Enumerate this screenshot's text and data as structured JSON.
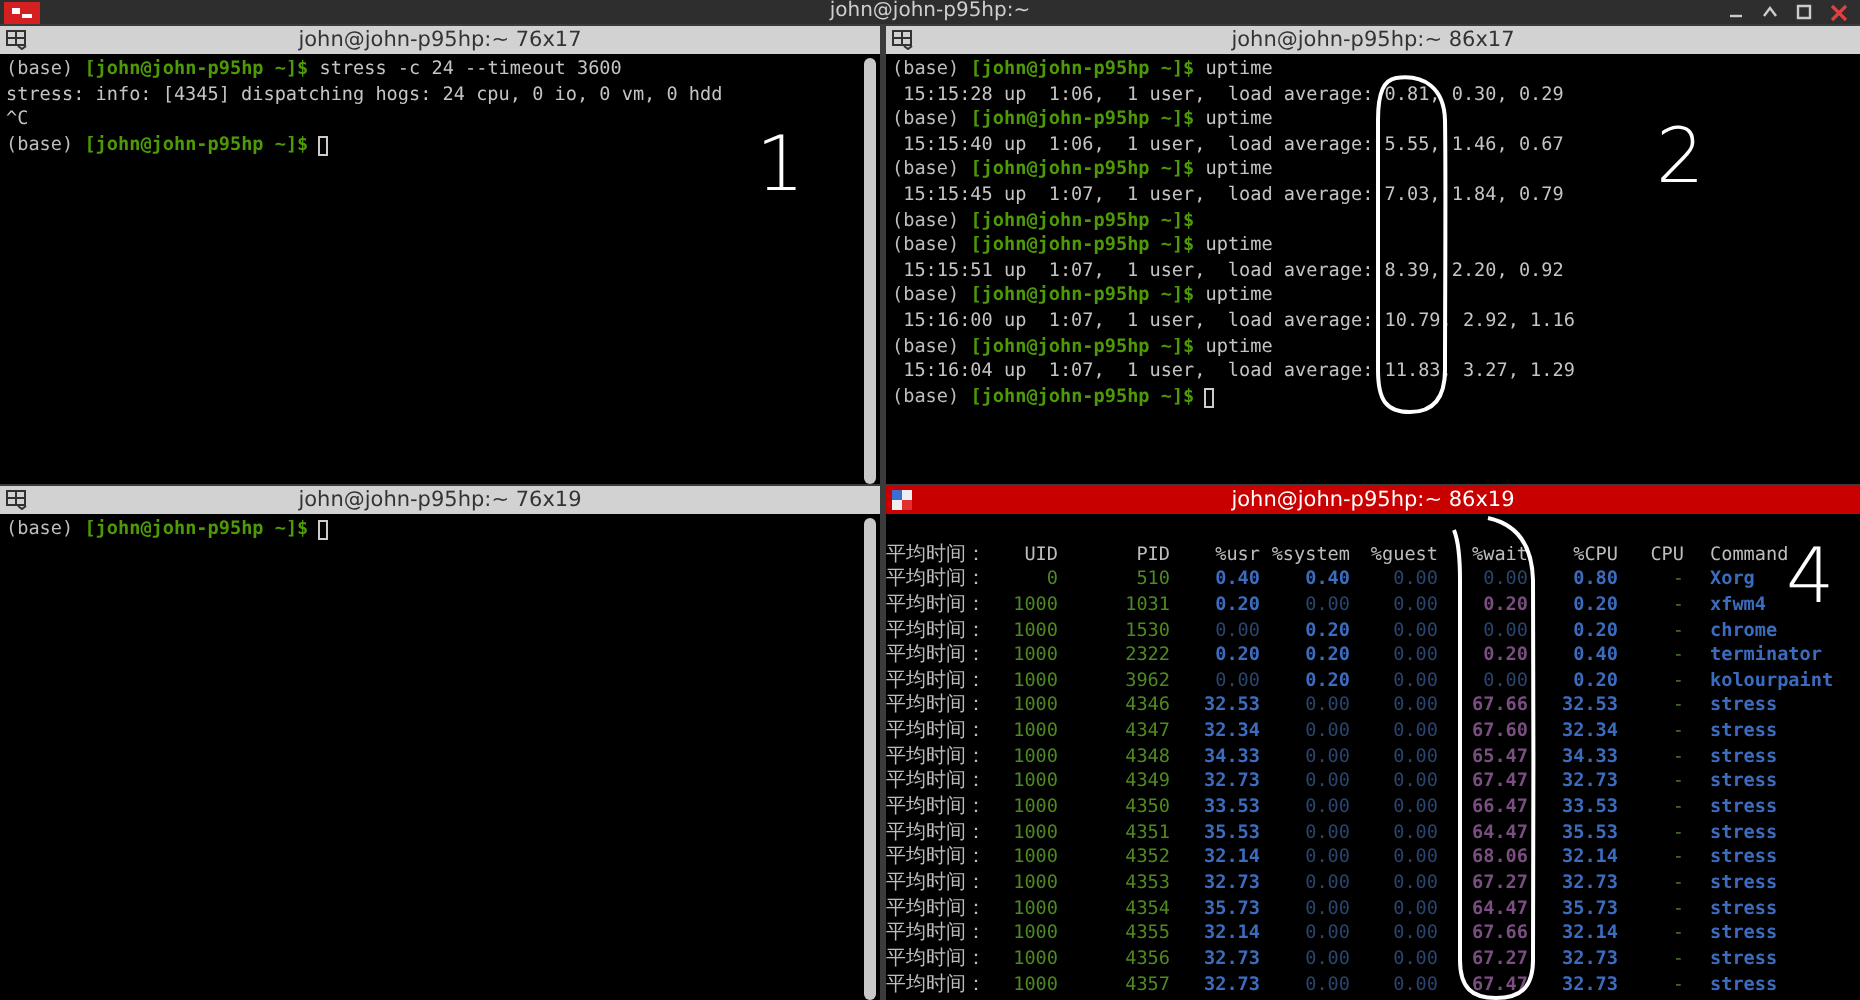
{
  "window": {
    "title": "john@john-p95hp:~"
  },
  "panes": [
    {
      "title": "john@john-p95hp:~ 76x17",
      "active": false,
      "scrollbar": true,
      "lines": [
        {
          "kind": "prompt",
          "env": "(base)",
          "prompt": "[john@john-p95hp ~]$",
          "command": "stress -c 24 --timeout 3600"
        },
        {
          "kind": "output",
          "text": "stress: info: [4345] dispatching hogs: 24 cpu, 0 io, 0 vm, 0 hdd"
        },
        {
          "kind": "output",
          "text": "^C"
        },
        {
          "kind": "prompt",
          "env": "(base)",
          "prompt": "[john@john-p95hp ~]$",
          "cursor": true
        }
      ]
    },
    {
      "title": "john@john-p95hp:~ 86x17",
      "active": false,
      "scrollbar": false,
      "lines": [
        {
          "kind": "prompt",
          "env": "(base)",
          "prompt": "[john@john-p95hp ~]$",
          "command": "uptime"
        },
        {
          "kind": "output",
          "text": " 15:15:28 up  1:06,  1 user,  load average: 0.81, 0.30, 0.29"
        },
        {
          "kind": "prompt",
          "env": "(base)",
          "prompt": "[john@john-p95hp ~]$",
          "command": "uptime"
        },
        {
          "kind": "output",
          "text": " 15:15:40 up  1:06,  1 user,  load average: 5.55, 1.46, 0.67"
        },
        {
          "kind": "prompt",
          "env": "(base)",
          "prompt": "[john@john-p95hp ~]$",
          "command": "uptime"
        },
        {
          "kind": "output",
          "text": " 15:15:45 up  1:07,  1 user,  load average: 7.03, 1.84, 0.79"
        },
        {
          "kind": "prompt",
          "env": "(base)",
          "prompt": "[john@john-p95hp ~]$"
        },
        {
          "kind": "prompt",
          "env": "(base)",
          "prompt": "[john@john-p95hp ~]$",
          "command": "uptime"
        },
        {
          "kind": "output",
          "text": " 15:15:51 up  1:07,  1 user,  load average: 8.39, 2.20, 0.92"
        },
        {
          "kind": "prompt",
          "env": "(base)",
          "prompt": "[john@john-p95hp ~]$",
          "command": "uptime"
        },
        {
          "kind": "output",
          "text": " 15:16:00 up  1:07,  1 user,  load average: 10.79, 2.92, 1.16"
        },
        {
          "kind": "prompt",
          "env": "(base)",
          "prompt": "[john@john-p95hp ~]$",
          "command": "uptime"
        },
        {
          "kind": "output",
          "text": " 15:16:04 up  1:07,  1 user,  load average: 11.83, 3.27, 1.29"
        },
        {
          "kind": "prompt",
          "env": "(base)",
          "prompt": "[john@john-p95hp ~]$",
          "cursor": true
        }
      ]
    },
    {
      "title": "john@john-p95hp:~ 76x19",
      "active": false,
      "scrollbar": true,
      "lines": [
        {
          "kind": "prompt",
          "env": "(base)",
          "prompt": "[john@john-p95hp ~]$",
          "cursor": true
        }
      ]
    },
    {
      "title": "john@john-p95hp:~ 86x19",
      "active": true,
      "scrollbar": false,
      "table": {
        "columns": [
          {
            "label": "平均时间：",
            "kind": "label"
          },
          {
            "label": "UID",
            "kind": "id"
          },
          {
            "label": "PID",
            "kind": "id"
          },
          {
            "label": "%usr",
            "kind": "num"
          },
          {
            "label": "%system",
            "kind": "num"
          },
          {
            "label": "%guest",
            "kind": "num"
          },
          {
            "label": "%wait",
            "kind": "wait"
          },
          {
            "label": "%CPU",
            "kind": "num"
          },
          {
            "label": "CPU",
            "kind": "cpu"
          },
          {
            "label": "Command",
            "kind": "command"
          }
        ],
        "rows": [
          {
            "cells": [
              "平均时间：",
              "0",
              "510",
              "0.40",
              "0.40",
              "0.00",
              "0.00",
              "0.80",
              "-",
              "Xorg"
            ],
            "bold": [
              false,
              false,
              false,
              true,
              true,
              false,
              false,
              true,
              false,
              true
            ]
          },
          {
            "cells": [
              "平均时间：",
              "1000",
              "1031",
              "0.20",
              "0.00",
              "0.00",
              "0.20",
              "0.20",
              "-",
              "xfwm4"
            ],
            "bold": [
              false,
              false,
              false,
              true,
              false,
              false,
              true,
              true,
              false,
              true
            ]
          },
          {
            "cells": [
              "平均时间：",
              "1000",
              "1530",
              "0.00",
              "0.20",
              "0.00",
              "0.00",
              "0.20",
              "-",
              "chrome"
            ],
            "bold": [
              false,
              false,
              false,
              false,
              true,
              false,
              false,
              true,
              false,
              true
            ]
          },
          {
            "cells": [
              "平均时间：",
              "1000",
              "2322",
              "0.20",
              "0.20",
              "0.00",
              "0.20",
              "0.40",
              "-",
              "terminator"
            ],
            "bold": [
              false,
              false,
              false,
              true,
              true,
              false,
              true,
              true,
              false,
              true
            ]
          },
          {
            "cells": [
              "平均时间：",
              "1000",
              "3962",
              "0.00",
              "0.20",
              "0.00",
              "0.00",
              "0.20",
              "-",
              "kolourpaint"
            ],
            "bold": [
              false,
              false,
              false,
              false,
              true,
              false,
              false,
              true,
              false,
              true
            ]
          },
          {
            "cells": [
              "平均时间：",
              "1000",
              "4346",
              "32.53",
              "0.00",
              "0.00",
              "67.66",
              "32.53",
              "-",
              "stress"
            ],
            "bold": [
              false,
              false,
              false,
              true,
              false,
              false,
              true,
              true,
              false,
              true
            ]
          },
          {
            "cells": [
              "平均时间：",
              "1000",
              "4347",
              "32.34",
              "0.00",
              "0.00",
              "67.60",
              "32.34",
              "-",
              "stress"
            ],
            "bold": [
              false,
              false,
              false,
              true,
              false,
              false,
              true,
              true,
              false,
              true
            ]
          },
          {
            "cells": [
              "平均时间：",
              "1000",
              "4348",
              "34.33",
              "0.00",
              "0.00",
              "65.47",
              "34.33",
              "-",
              "stress"
            ],
            "bold": [
              false,
              false,
              false,
              true,
              false,
              false,
              true,
              true,
              false,
              true
            ]
          },
          {
            "cells": [
              "平均时间：",
              "1000",
              "4349",
              "32.73",
              "0.00",
              "0.00",
              "67.47",
              "32.73",
              "-",
              "stress"
            ],
            "bold": [
              false,
              false,
              false,
              true,
              false,
              false,
              true,
              true,
              false,
              true
            ]
          },
          {
            "cells": [
              "平均时间：",
              "1000",
              "4350",
              "33.53",
              "0.00",
              "0.00",
              "66.47",
              "33.53",
              "-",
              "stress"
            ],
            "bold": [
              false,
              false,
              false,
              true,
              false,
              false,
              true,
              true,
              false,
              true
            ]
          },
          {
            "cells": [
              "平均时间：",
              "1000",
              "4351",
              "35.53",
              "0.00",
              "0.00",
              "64.47",
              "35.53",
              "-",
              "stress"
            ],
            "bold": [
              false,
              false,
              false,
              true,
              false,
              false,
              true,
              true,
              false,
              true
            ]
          },
          {
            "cells": [
              "平均时间：",
              "1000",
              "4352",
              "32.14",
              "0.00",
              "0.00",
              "68.06",
              "32.14",
              "-",
              "stress"
            ],
            "bold": [
              false,
              false,
              false,
              true,
              false,
              false,
              true,
              true,
              false,
              true
            ]
          },
          {
            "cells": [
              "平均时间：",
              "1000",
              "4353",
              "32.73",
              "0.00",
              "0.00",
              "67.27",
              "32.73",
              "-",
              "stress"
            ],
            "bold": [
              false,
              false,
              false,
              true,
              false,
              false,
              true,
              true,
              false,
              true
            ]
          },
          {
            "cells": [
              "平均时间：",
              "1000",
              "4354",
              "35.73",
              "0.00",
              "0.00",
              "64.47",
              "35.73",
              "-",
              "stress"
            ],
            "bold": [
              false,
              false,
              false,
              true,
              false,
              false,
              true,
              true,
              false,
              true
            ]
          },
          {
            "cells": [
              "平均时间：",
              "1000",
              "4355",
              "32.14",
              "0.00",
              "0.00",
              "67.66",
              "32.14",
              "-",
              "stress"
            ],
            "bold": [
              false,
              false,
              false,
              true,
              false,
              false,
              true,
              true,
              false,
              true
            ]
          },
          {
            "cells": [
              "平均时间：",
              "1000",
              "4356",
              "32.73",
              "0.00",
              "0.00",
              "67.27",
              "32.73",
              "-",
              "stress"
            ],
            "bold": [
              false,
              false,
              false,
              true,
              false,
              false,
              true,
              true,
              false,
              true
            ]
          },
          {
            "cells": [
              "平均时间：",
              "1000",
              "4357",
              "32.73",
              "0.00",
              "0.00",
              "67.47",
              "32.73",
              "-",
              "stress"
            ],
            "bold": [
              false,
              false,
              false,
              true,
              false,
              false,
              true,
              true,
              false,
              true
            ]
          }
        ]
      }
    }
  ],
  "annotations": [
    {
      "text": "1",
      "kind": "pane1"
    },
    {
      "text": "2",
      "kind": "pane2"
    },
    {
      "text": "4",
      "kind": "pane4"
    }
  ]
}
